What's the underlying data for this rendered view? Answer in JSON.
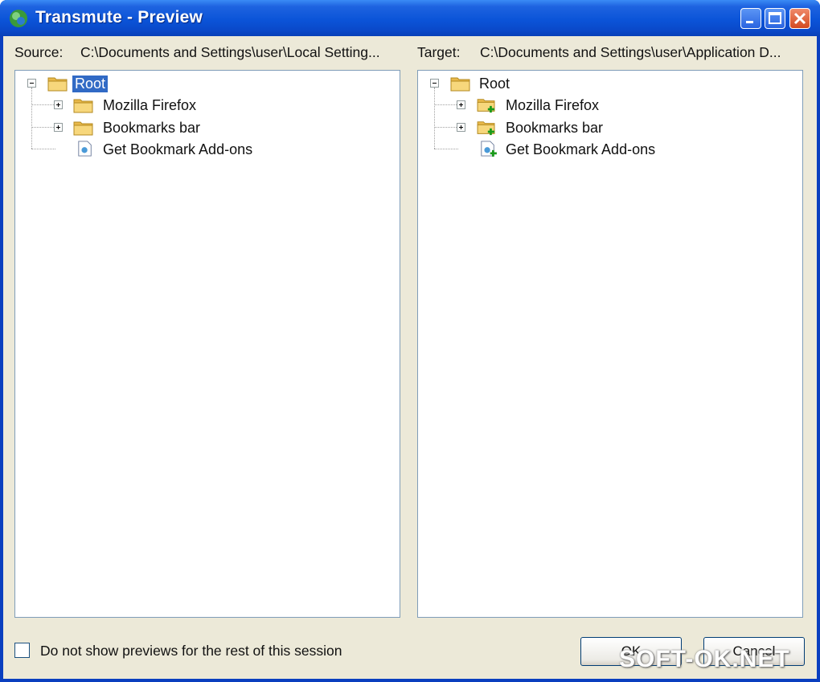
{
  "window": {
    "title": "Transmute - Preview"
  },
  "source": {
    "label": "Source:",
    "path": "C:\\Documents and Settings\\user\\Local Setting..."
  },
  "target": {
    "label": "Target:",
    "path": "C:\\Documents and Settings\\user\\Application D..."
  },
  "source_tree": {
    "root": "Root",
    "items": [
      "Mozilla Firefox",
      "Bookmarks bar",
      "Get Bookmark Add-ons"
    ]
  },
  "target_tree": {
    "root": "Root",
    "items": [
      "Mozilla Firefox",
      "Bookmarks bar",
      "Get Bookmark Add-ons"
    ]
  },
  "footer": {
    "checkbox_label": "Do not show previews for the rest of this session",
    "ok_label": "OK",
    "cancel_label": "Cancel"
  },
  "watermark": "SOFT-OK.NET",
  "colors": {
    "titlebar": "#0b54d8",
    "selection": "#316ac5",
    "face": "#ece9d8"
  }
}
